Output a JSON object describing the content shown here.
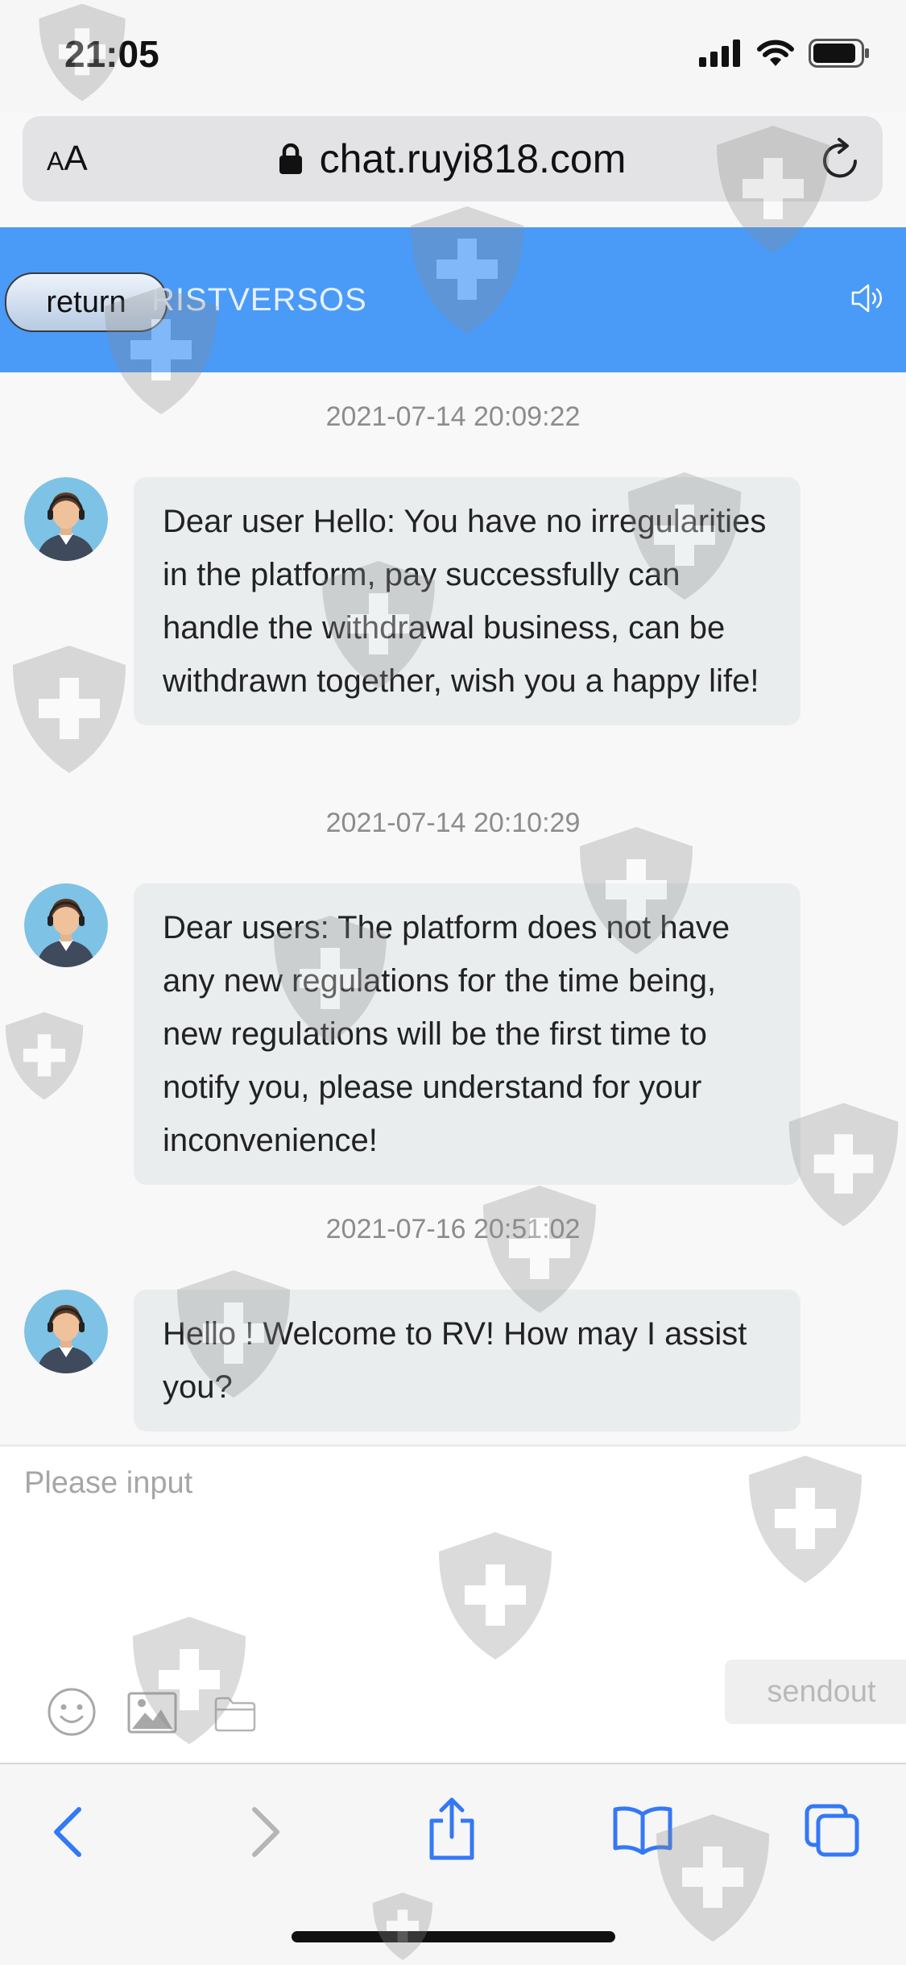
{
  "status_bar": {
    "time": "21:05"
  },
  "browser": {
    "url": "chat.ruyi818.com",
    "text_size_label_small": "A",
    "text_size_label_large": "A"
  },
  "header": {
    "return_label": "return",
    "title": "RISTVERSOS"
  },
  "messages": [
    {
      "time": "2021-07-14 20:09:22",
      "text": "Dear user Hello: You have no irregularities in the platform, pay successfully can handle the withdrawal business, can be withdrawn together, wish you a happy life!"
    },
    {
      "time": "2021-07-14 20:10:29",
      "text": "Dear users: The platform does not have any new regulations for the time being, new regulations will be the first time to notify you, please understand for your inconvenience!"
    },
    {
      "time": "2021-07-16 20:51:02",
      "text": "Hello ! Welcome to RV! How may I assist you?"
    }
  ],
  "input": {
    "placeholder": "Please input",
    "send_label": "sendout"
  },
  "icons": {
    "status": [
      "signal-icon",
      "wifi-icon",
      "battery-icon"
    ],
    "toolbar": [
      "emoji-icon",
      "image-icon",
      "folder-icon"
    ],
    "navigation": [
      "back-icon",
      "forward-icon",
      "share-icon",
      "bookmarks-icon",
      "tabs-icon"
    ]
  },
  "colors": {
    "header": "#4a9af7",
    "ios_blue": "#3478f6",
    "bubble": "#e9edee"
  }
}
